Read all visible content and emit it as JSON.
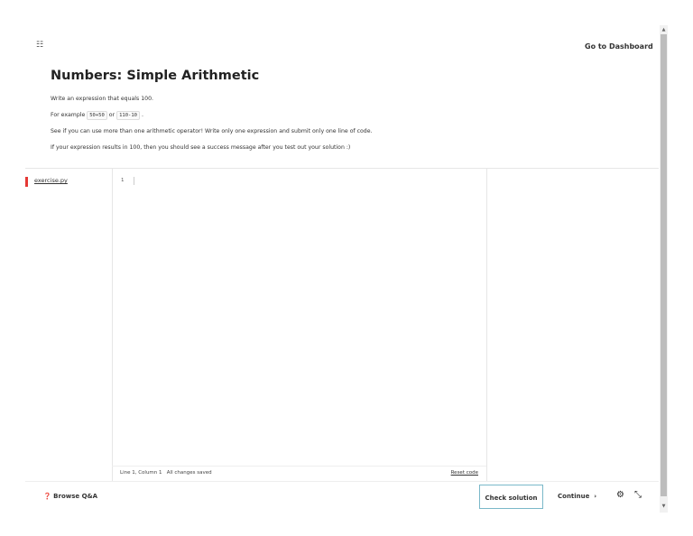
{
  "header": {
    "menu_icon": "list-icon",
    "dashboard_link": "Go to Dashboard"
  },
  "lesson": {
    "title": "Numbers: Simple Arithmetic",
    "line1": "Write an expression that equals 100.",
    "line2_prefix": "For example",
    "code1": "50+50",
    "or": "or",
    "code2": "110-10",
    "line2_suffix": ".",
    "line3": "See if you can use more than one arithmetic operator! Write only one expression and submit only one line of code.",
    "line4": "If your expression results in 100, then you should see a success message after you test out your solution :)"
  },
  "editor": {
    "file": "exercise.py",
    "line_number": "1",
    "status_position": "Line 1, Column 1",
    "status_saved": "All changes saved",
    "reset": "Reset code"
  },
  "footer": {
    "browse": "Browse Q&A",
    "check": "Check solution",
    "continue": "Continue",
    "continue_icon": "›"
  }
}
